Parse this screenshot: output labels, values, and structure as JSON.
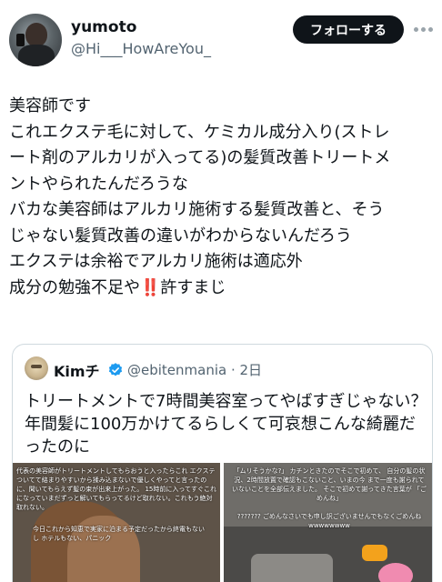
{
  "author": {
    "display_name": "yumoto",
    "handle": "@Hi___HowAreYou_",
    "avatar_icon": "user-avatar-photo"
  },
  "header": {
    "follow_label": "フォローする",
    "more_icon": "more-dots-icon"
  },
  "tweet": {
    "lines": [
      "美容師です",
      "これエクステ毛に対して、ケミカル成分入り(ストレ",
      "ート剤のアルカリが入ってる)の髪質改善トリートメ",
      "ントやられたんだろうな",
      "バカな美容師はアルカリ施術する髪質改善と、そう",
      "じゃない髪質改善の違いがわからないんだろう",
      "エクステは余裕でアルカリ施術は適応外"
    ],
    "last_line_prefix": "成分の勉強不足や",
    "last_line_emoji": "‼️",
    "last_line_suffix": "許すまじ"
  },
  "quote": {
    "display_name": "Kimチ",
    "verified_icon": "verified-badge-icon",
    "handle_time": "@ebitenmania · 2日",
    "lines": [
      "トリートメントで7時間美容室ってやばすぎじゃない？",
      "年間髪に100万かけてるらしくて可哀想こんな綺麗だ",
      "ったのに"
    ],
    "media_left": {
      "caption_top": "代表の美容師がトリートメントしてもらおうと入ったらこれ エクステついてて絡まりやすいから揉み込まないで優しくやってと言ったのに、聞いてもらえず髪の束が出来上がった。 15時前に入ってすぐこれになっていまだずっと解いてもらってるけど取れない。これもう絶対取れない。",
      "caption_bottom": "今日これから知恵で実家に泊まる予定だったから終電もないし ホテルもない、パニック"
    },
    "media_right": {
      "caption_top": "「ムリそうかな?」 カチンときたのでそこで初めて、 自分の髪の状況、2時間放置で確認もこないこと、いまの今 まで一度も謝られていないことを全部伝えました。 そこで初めて謝ってきた言葉が 「ごめんね」",
      "caption_bottom": "??????? ごめんなさいでも申し訳ございませんでもなくごめんね wwwwwwww"
    },
    "colors": {
      "link_blue": "#1d9bf0",
      "border": "#cfd9de",
      "secondary_text": "#536471"
    }
  }
}
